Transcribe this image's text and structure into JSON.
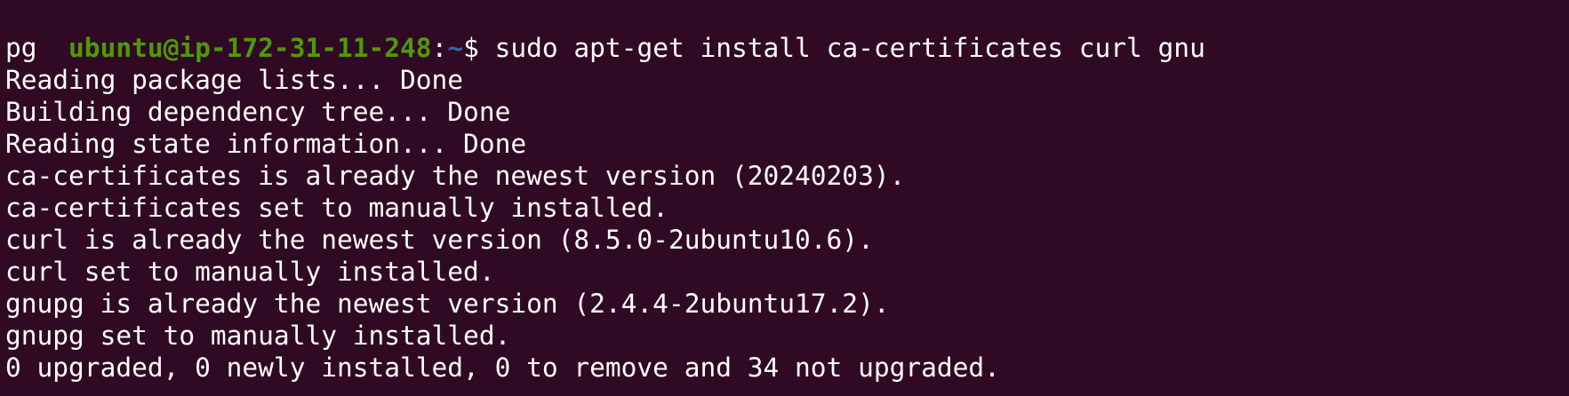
{
  "terminal": {
    "prompt": {
      "user_host": "ubuntu@ip-172-31-11-248",
      "separator": ":",
      "path": "~",
      "symbol": "$ ",
      "command": "sudo apt-get install ca-certificates curl gnu"
    },
    "command_wrap": "pg",
    "output": [
      "Reading package lists... Done",
      "Building dependency tree... Done",
      "Reading state information... Done",
      "ca-certificates is already the newest version (20240203).",
      "ca-certificates set to manually installed.",
      "curl is already the newest version (8.5.0-2ubuntu10.6).",
      "curl set to manually installed.",
      "gnupg is already the newest version (2.4.4-2ubuntu17.2).",
      "gnupg set to manually installed.",
      "0 upgraded, 0 newly installed, 0 to remove and 34 not upgraded."
    ],
    "colors": {
      "background": "#300a24",
      "user_host": "#4e9a06",
      "path": "#3465a4",
      "text": "#ffffff"
    }
  }
}
